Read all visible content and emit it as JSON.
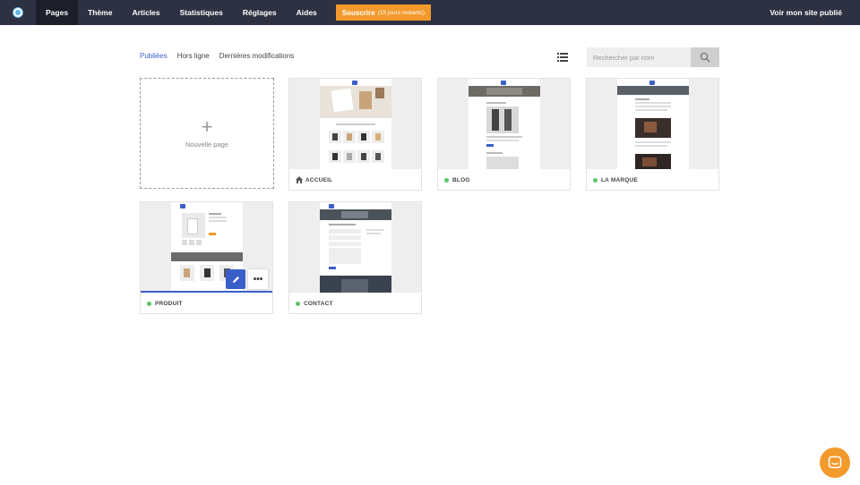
{
  "nav": {
    "items": [
      {
        "label": "Pages"
      },
      {
        "label": "Thème"
      },
      {
        "label": "Articles"
      },
      {
        "label": "Statistiques"
      },
      {
        "label": "Réglages"
      },
      {
        "label": "Aides"
      }
    ],
    "subscribe_label": "Souscrire",
    "subscribe_note": "(15 jours restants)",
    "view_site_label": "Voir mon site publié"
  },
  "filters": {
    "published": "Publiées",
    "offline": "Hors ligne",
    "recent": "Dernières modifications"
  },
  "search": {
    "placeholder": "Rechercher par nom"
  },
  "new_page_label": "Nouvelle page",
  "pages": [
    {
      "label": "ACCUEIL",
      "status": "home"
    },
    {
      "label": "BLOG",
      "status": "published"
    },
    {
      "label": "LA MARQUE",
      "status": "published"
    },
    {
      "label": "PRODUIT",
      "status": "published"
    },
    {
      "label": "CONTACT",
      "status": "published"
    }
  ],
  "colors": {
    "topbar": "#2d3142",
    "accent": "#3b5fc9",
    "subscribe": "#f39a2c",
    "published_dot": "#5cc46a"
  },
  "icons": [
    "logo-icon",
    "list-view-icon",
    "search-icon",
    "home-icon",
    "pencil-icon",
    "more-icon",
    "chat-icon"
  ]
}
